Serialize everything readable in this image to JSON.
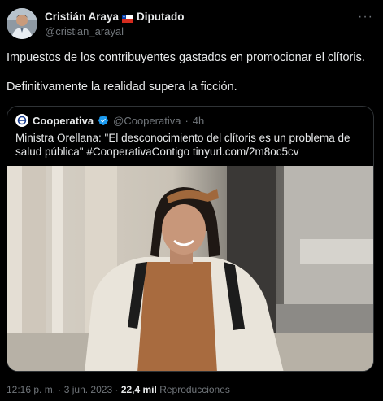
{
  "author": {
    "display_name": "Cristián Araya",
    "role": "Diputado",
    "handle": "@cristian_arayal",
    "flag_icon": "chile-flag-icon"
  },
  "menu": {
    "icon": "more-icon",
    "label": "···"
  },
  "tweet": {
    "line1": "Impuestos de los contribuyentes gastados en promocionar el clítoris.",
    "line2": "Definitivamente la realidad supera la ficción."
  },
  "quoted": {
    "name": "Cooperativa",
    "handle": "@Cooperativa",
    "separator": "·",
    "time": "4h",
    "verified_icon": "verified-badge-icon",
    "text": "Ministra Orellana: \"El desconocimiento del clítoris es un problema de salud pública\" #CooperativaContigo tinyurl.com/2m8oc5cv"
  },
  "meta": {
    "time": "12:16 p. m.",
    "separator": "·",
    "date": "3 jun. 2023",
    "views_count": "22,4 mil",
    "views_label": "Reproducciones"
  },
  "colors": {
    "background": "#000000",
    "text": "#e7e9ea",
    "muted": "#71767b",
    "border": "#2f3336",
    "verified": "#1d9bf0"
  }
}
